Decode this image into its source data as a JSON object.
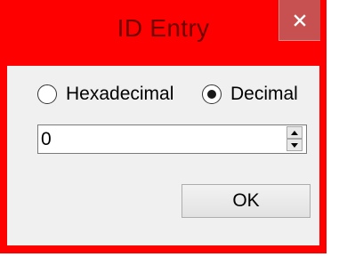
{
  "window": {
    "title": "ID Entry",
    "close_icon": "close-icon"
  },
  "colors": {
    "frame": "#fe0000",
    "title_text": "#6e0000",
    "close_button": "#c75050",
    "client_background": "#f0f0f0"
  },
  "format": {
    "options": [
      {
        "label": "Hexadecimal",
        "selected": false
      },
      {
        "label": "Decimal",
        "selected": true
      }
    ]
  },
  "id_field": {
    "value": "0",
    "up_icon": "arrow-up-icon",
    "down_icon": "arrow-down-icon"
  },
  "actions": {
    "ok_label": "OK"
  }
}
